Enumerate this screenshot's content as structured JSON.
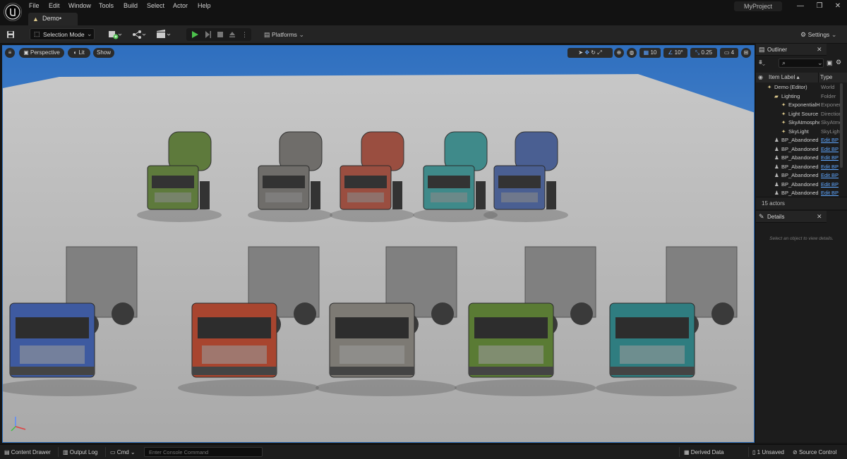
{
  "menu": {
    "items": [
      "File",
      "Edit",
      "Window",
      "Tools",
      "Build",
      "Select",
      "Actor",
      "Help"
    ]
  },
  "tab": {
    "title": "Demo•"
  },
  "project": {
    "name": "MyProject"
  },
  "toolbar": {
    "selection_mode": "Selection Mode",
    "platforms": "Platforms",
    "settings": "Settings"
  },
  "viewport": {
    "perspective": "Perspective",
    "lit": "Lit",
    "show": "Show",
    "grid_snap": "10",
    "rotation_snap": "10°",
    "scale_snap": "0.25",
    "camera_speed": "4"
  },
  "outliner": {
    "title": "Outliner",
    "col_label": "Item Label ▴",
    "col_type": "Type",
    "rows": [
      {
        "label": "Demo (Editor)",
        "type": "World",
        "indent": 1,
        "link": false
      },
      {
        "label": "Lighting",
        "type": "Folder",
        "indent": 2,
        "link": false
      },
      {
        "label": "ExponentialHeightFog",
        "type": "ExponentialHeightFog",
        "indent": 3,
        "link": false
      },
      {
        "label": "Light Source",
        "type": "DirectionalLight",
        "indent": 3,
        "link": false
      },
      {
        "label": "SkyAtmosphere",
        "type": "SkyAtmosphere",
        "indent": 3,
        "link": false
      },
      {
        "label": "SkyLight",
        "type": "SkyLight",
        "indent": 3,
        "link": false
      },
      {
        "label": "BP_Abandoned",
        "type": "Edit BP",
        "indent": 2,
        "link": true
      },
      {
        "label": "BP_Abandoned",
        "type": "Edit BP",
        "indent": 2,
        "link": true
      },
      {
        "label": "BP_Abandoned",
        "type": "Edit BP",
        "indent": 2,
        "link": true
      },
      {
        "label": "BP_Abandoned",
        "type": "Edit BP",
        "indent": 2,
        "link": true
      },
      {
        "label": "BP_Abandoned",
        "type": "Edit BP",
        "indent": 2,
        "link": true
      },
      {
        "label": "BP_Abandoned",
        "type": "Edit BP",
        "indent": 2,
        "link": true
      },
      {
        "label": "BP_Abandoned",
        "type": "Edit BP",
        "indent": 2,
        "link": true
      }
    ],
    "actor_count": "15 actors"
  },
  "details": {
    "title": "Details",
    "empty_message": "Select an object to view details."
  },
  "statusbar": {
    "content_drawer": "Content Drawer",
    "output_log": "Output Log",
    "cmd": "Cmd",
    "console_placeholder": "Enter Console Command",
    "derived_data": "Derived Data",
    "unsaved": "1 Unsaved",
    "source_control": "Source Control"
  },
  "trucks": {
    "back_row": [
      {
        "color": "#5e7a3c"
      },
      {
        "color": "#6f6d6a"
      },
      {
        "color": "#9a4e40"
      },
      {
        "color": "#3f8a8a"
      },
      {
        "color": "#4a5f92"
      }
    ],
    "front_row": [
      {
        "color": "#3e5aa0"
      },
      {
        "color": "#a8452f"
      },
      {
        "color": "#7d7a74"
      },
      {
        "color": "#5a7b34"
      },
      {
        "color": "#2f7d80"
      }
    ]
  }
}
